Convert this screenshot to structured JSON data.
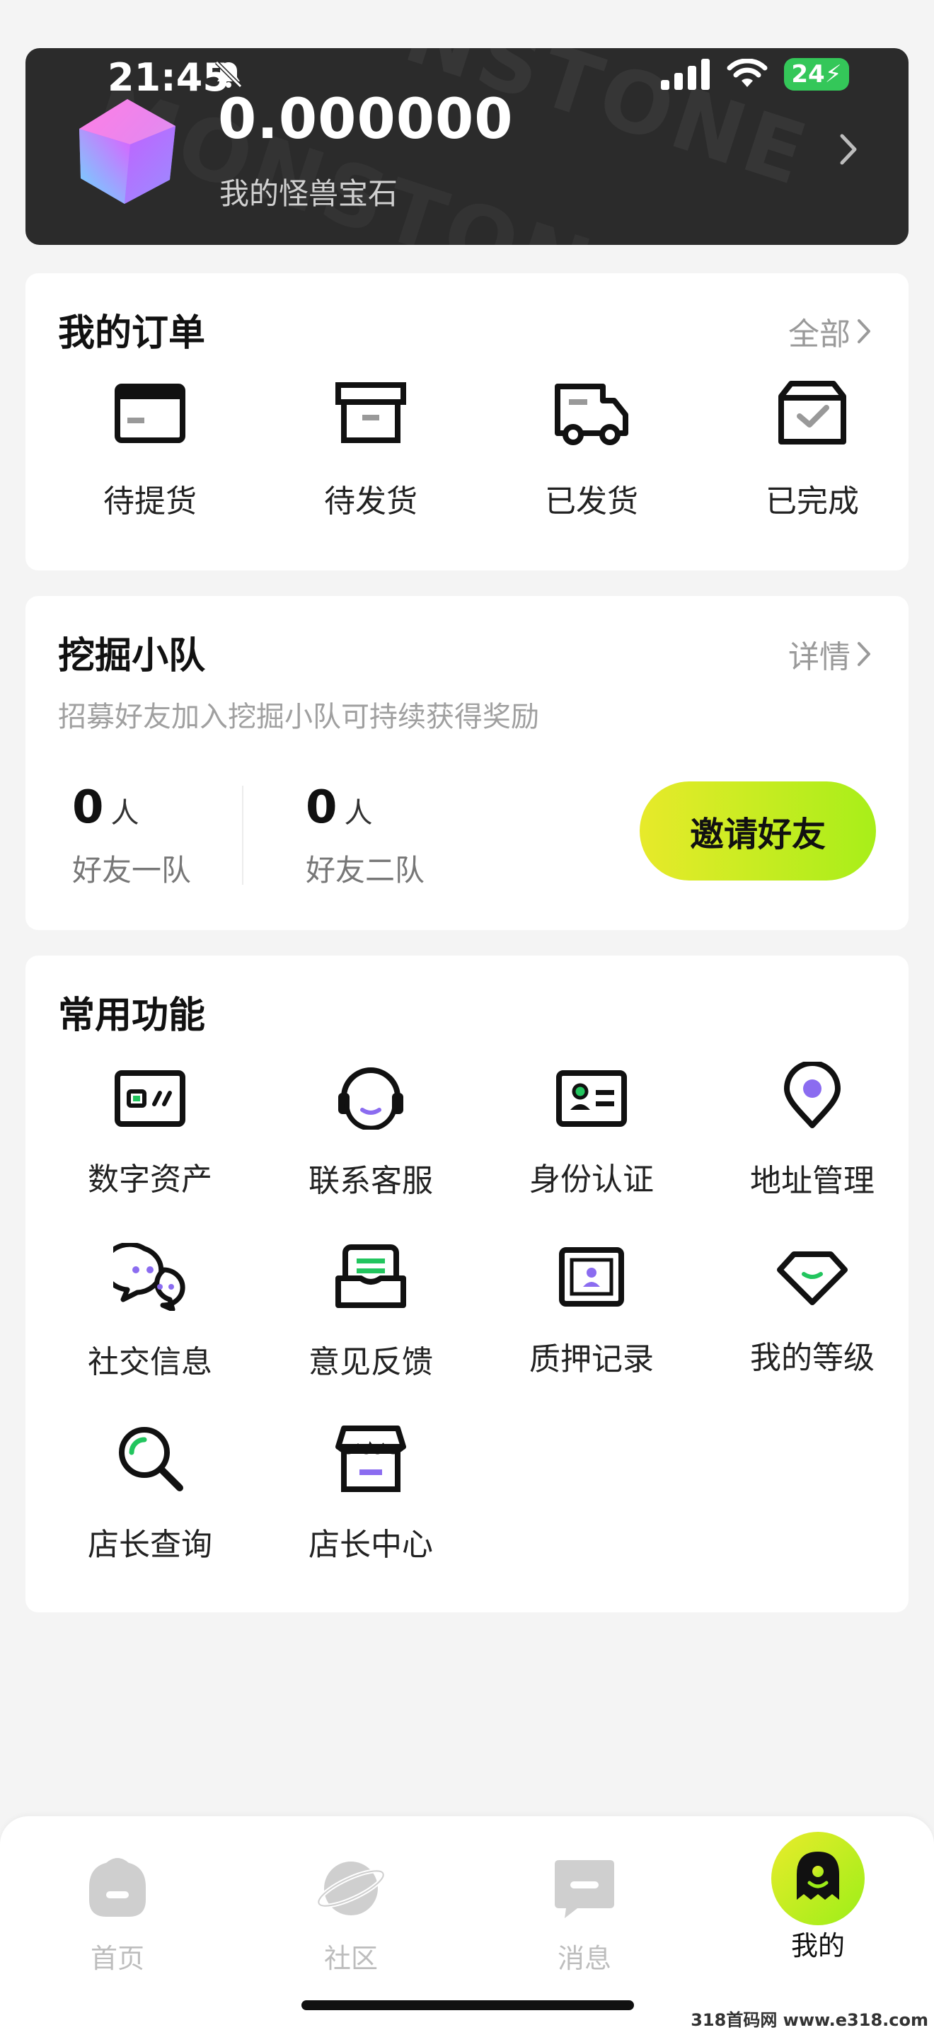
{
  "status_bar": {
    "time": "21:45",
    "battery": "24"
  },
  "gem_card": {
    "value": "0.000000",
    "label": "我的怪兽宝石",
    "background_text": "MONSTONE",
    "colors": {
      "background": "#2b2b2b"
    }
  },
  "orders": {
    "title": "我的订单",
    "link": "全部",
    "items": [
      {
        "label": "待提货",
        "icon": "card-icon"
      },
      {
        "label": "待发货",
        "icon": "box-icon"
      },
      {
        "label": "已发货",
        "icon": "truck-icon"
      },
      {
        "label": "已完成",
        "icon": "package-check-icon"
      }
    ]
  },
  "team": {
    "title": "挖掘小队",
    "link": "详情",
    "subtitle": "招募好友加入挖掘小队可持续获得奖励",
    "stats": [
      {
        "count": "0",
        "unit": "人",
        "label": "好友一队"
      },
      {
        "count": "0",
        "unit": "人",
        "label": "好友二队"
      }
    ],
    "invite_label": "邀请好友",
    "colors": {
      "invite_start": "#e7ea2a",
      "invite_end": "#a8ee19"
    }
  },
  "functions": {
    "title": "常用功能",
    "items": [
      {
        "label": "数字资产",
        "icon": "wallet-icon"
      },
      {
        "label": "联系客服",
        "icon": "headset-icon"
      },
      {
        "label": "身份认证",
        "icon": "id-card-icon"
      },
      {
        "label": "地址管理",
        "icon": "location-pin-icon"
      },
      {
        "label": "社交信息",
        "icon": "chat-bubbles-icon"
      },
      {
        "label": "意见反馈",
        "icon": "feedback-inbox-icon"
      },
      {
        "label": "质押记录",
        "icon": "pledge-record-icon"
      },
      {
        "label": "我的等级",
        "icon": "level-gem-icon"
      },
      {
        "label": "店长查询",
        "icon": "magnifier-icon"
      },
      {
        "label": "店长中心",
        "icon": "store-icon"
      }
    ],
    "colors": {
      "green": "#22c55e",
      "purple": "#8b6cf0"
    }
  },
  "tabbar": {
    "tabs": [
      {
        "label": "首页",
        "icon": "home-icon",
        "active": false
      },
      {
        "label": "社区",
        "icon": "planet-icon",
        "active": false
      },
      {
        "label": "消息",
        "icon": "message-icon",
        "active": false
      },
      {
        "label": "我的",
        "icon": "profile-ghost-icon",
        "active": true
      }
    ]
  },
  "watermark": "318首码网 www.e318.com"
}
